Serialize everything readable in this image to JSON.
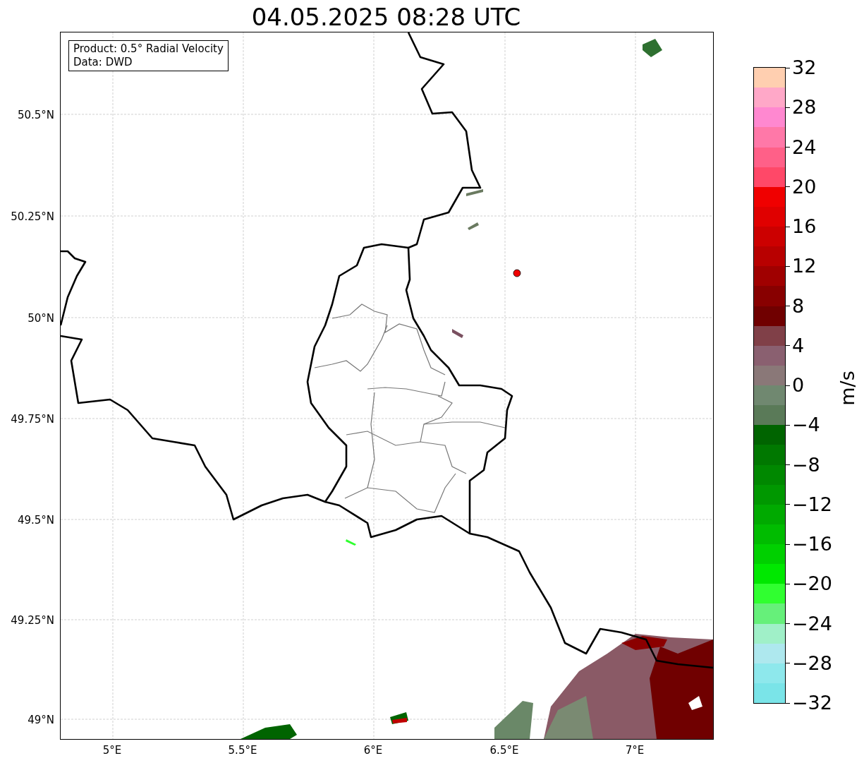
{
  "title": "04.05.2025 08:28 UTC",
  "info_box": [
    "Product: 0.5° Radial Velocity",
    "Data: DWD"
  ],
  "y_axis": {
    "ticks": [
      "50.5°N",
      "50.25°N",
      "50°N",
      "49.75°N",
      "49.5°N",
      "49.25°N",
      "49°N"
    ]
  },
  "x_axis": {
    "ticks": [
      "5°E",
      "5.5°E",
      "6°E",
      "6.5°E",
      "7°E"
    ]
  },
  "colorbar": {
    "label": "m/s",
    "ticks": [
      "32",
      "28",
      "24",
      "20",
      "16",
      "12",
      "8",
      "4",
      "0",
      "−4",
      "−8",
      "−12",
      "−16",
      "−20",
      "−24",
      "−28",
      "−32"
    ],
    "segments": [
      {
        "color": "#ffcfb0"
      },
      {
        "color": "#ffa8c8"
      },
      {
        "color": "#ff88d0"
      },
      {
        "color": "#ff78a8"
      },
      {
        "color": "#ff6088"
      },
      {
        "color": "#ff4868"
      },
      {
        "color": "#f00000"
      },
      {
        "color": "#e00000"
      },
      {
        "color": "#cc0000"
      },
      {
        "color": "#b80000"
      },
      {
        "color": "#a00000"
      },
      {
        "color": "#880000"
      },
      {
        "color": "#700000"
      },
      {
        "color": "#804048"
      },
      {
        "color": "#8a6070"
      },
      {
        "color": "#8a7878"
      },
      {
        "color": "#708870"
      },
      {
        "color": "#5a7a58"
      },
      {
        "color": "#006400"
      },
      {
        "color": "#007800"
      },
      {
        "color": "#008800"
      },
      {
        "color": "#009800"
      },
      {
        "color": "#00aa00"
      },
      {
        "color": "#00bc00"
      },
      {
        "color": "#00d000"
      },
      {
        "color": "#00e800"
      },
      {
        "color": "#30ff30"
      },
      {
        "color": "#66f07a"
      },
      {
        "color": "#a0f0c8"
      },
      {
        "color": "#aee8ee"
      },
      {
        "color": "#8ee8ec"
      },
      {
        "color": "#7ae4e8"
      }
    ]
  }
}
